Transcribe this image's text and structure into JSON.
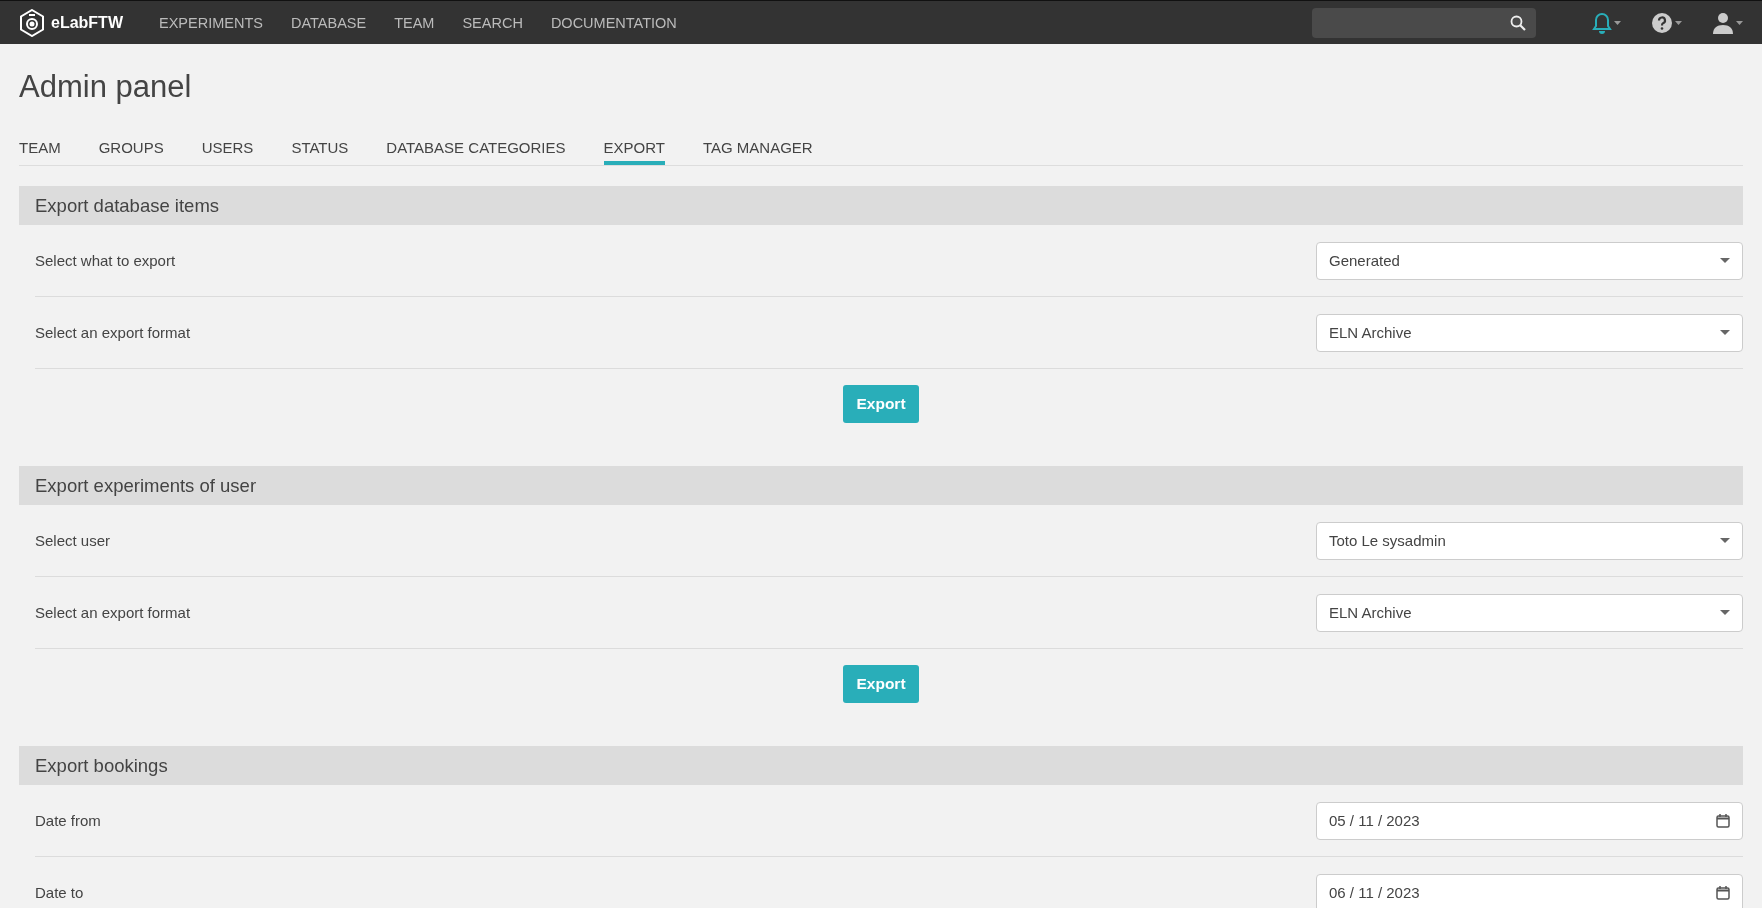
{
  "navbar": {
    "brand": "eLabFTW",
    "links": [
      "EXPERIMENTS",
      "DATABASE",
      "TEAM",
      "SEARCH",
      "DOCUMENTATION"
    ]
  },
  "page_title": "Admin panel",
  "tabs": [
    {
      "label": "TEAM",
      "selected": false
    },
    {
      "label": "GROUPS",
      "selected": false
    },
    {
      "label": "USERS",
      "selected": false
    },
    {
      "label": "STATUS",
      "selected": false
    },
    {
      "label": "DATABASE CATEGORIES",
      "selected": false
    },
    {
      "label": "EXPORT",
      "selected": true
    },
    {
      "label": "TAG MANAGER",
      "selected": false
    }
  ],
  "sections": [
    {
      "title": "Export database items",
      "rows": [
        {
          "kind": "select",
          "label": "Select what to export",
          "value": "Generated"
        },
        {
          "kind": "select",
          "label": "Select an export format",
          "value": "ELN Archive"
        }
      ],
      "button": "Export"
    },
    {
      "title": "Export experiments of user",
      "rows": [
        {
          "kind": "select",
          "label": "Select user",
          "value": "Toto Le sysadmin"
        },
        {
          "kind": "select",
          "label": "Select an export format",
          "value": "ELN Archive"
        }
      ],
      "button": "Export"
    },
    {
      "title": "Export bookings",
      "rows": [
        {
          "kind": "date",
          "label": "Date from",
          "value": "05 / 11 / 2023"
        },
        {
          "kind": "date",
          "label": "Date to",
          "value": "06 / 11 / 2023"
        }
      ]
    }
  ]
}
